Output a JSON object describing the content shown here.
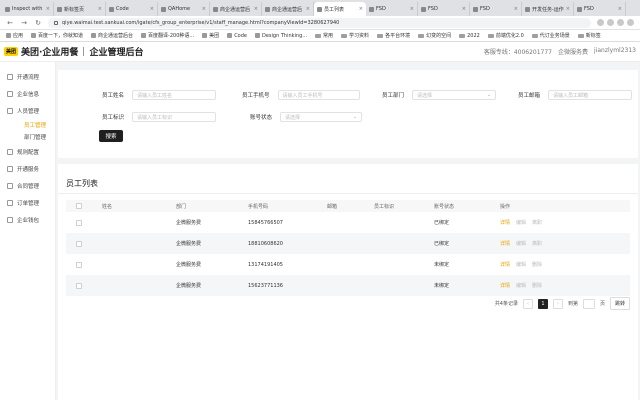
{
  "browser": {
    "tabs": [
      {
        "label": "Inspect with"
      },
      {
        "label": "新标签页"
      },
      {
        "label": "Code"
      },
      {
        "label": "QAHome"
      },
      {
        "label": "商企通运营后"
      },
      {
        "label": "商企通运营后"
      },
      {
        "label": "员工列表"
      },
      {
        "label": "FSD"
      },
      {
        "label": "FSD"
      },
      {
        "label": "FSD"
      },
      {
        "label": "开发任务-运作"
      },
      {
        "label": "FSD"
      }
    ],
    "url": "qiye.waimai.test.sankuai.com/igate/cfs_group_enterprise/v1/staff_manage.html?companyViewId=3280627940",
    "bookmarks": [
      "应用",
      "百度一下，你就知道",
      "商企通运营后台",
      "百度翻译-200种语...",
      "美团",
      "Code",
      "Design Thinking...",
      "常用",
      "学习资料",
      "各平台环境",
      "幻变的空间",
      "2022",
      "前端优化2.0",
      "代订业务场景",
      "新标签"
    ]
  },
  "header": {
    "logo_text": "美团",
    "brand": "美团·企业用餐",
    "title": "企业管理后台",
    "hotline": "客服专线：4006201777",
    "company": "企微服务费",
    "user": "jianzlyml2313"
  },
  "sidebar": {
    "items": [
      {
        "label": "开通流程"
      },
      {
        "label": "企业信息"
      },
      {
        "label": "人员管理"
      },
      {
        "label": "员工管理"
      },
      {
        "label": "部门管理"
      },
      {
        "label": "规则配置"
      },
      {
        "label": "开通服务"
      },
      {
        "label": "合同管理"
      },
      {
        "label": "订单管理"
      },
      {
        "label": "企业钱包"
      }
    ]
  },
  "filter": {
    "name_label": "员工姓名",
    "name_placeholder": "请输入员工姓名",
    "phone_label": "员工手机号",
    "phone_placeholder": "请输入员工手机号",
    "dept_label": "员工部门",
    "dept_placeholder": "请选择",
    "email_label": "员工邮箱",
    "email_placeholder": "请输入员工邮箱",
    "id_label": "员工标识",
    "id_placeholder": "请输入员工标识",
    "status_label": "账号状态",
    "status_placeholder": "请选择",
    "search_button": "搜索"
  },
  "list": {
    "title": "员工列表",
    "columns": [
      "姓名",
      "部门",
      "手机号码",
      "邮箱",
      "员工标识",
      "账号状态",
      "操作"
    ],
    "rows": [
      {
        "name": "",
        "dept": "企微服务费",
        "phone": "15845766507",
        "email": "",
        "staff_id": "",
        "status": "已绑定",
        "ops": [
          "详情",
          "编辑",
          "离职"
        ]
      },
      {
        "name": "",
        "dept": "企微服务费",
        "phone": "18810608620",
        "email": "",
        "staff_id": "",
        "status": "已绑定",
        "ops": [
          "详情",
          "编辑",
          "离职"
        ]
      },
      {
        "name": "",
        "dept": "企微服务费",
        "phone": "13174191405",
        "email": "",
        "staff_id": "",
        "status": "未绑定",
        "ops": [
          "详情",
          "编辑",
          "删除"
        ]
      },
      {
        "name": "",
        "dept": "企微服务费",
        "phone": "15623771136",
        "email": "",
        "staff_id": "",
        "status": "未绑定",
        "ops": [
          "详情",
          "编辑",
          "删除"
        ]
      }
    ],
    "pagination": {
      "total": "共4条记录",
      "prev": "‹",
      "current": "1",
      "next": "›",
      "goto_label": "到第",
      "page_suffix": "页",
      "go_button": "跳转"
    }
  }
}
